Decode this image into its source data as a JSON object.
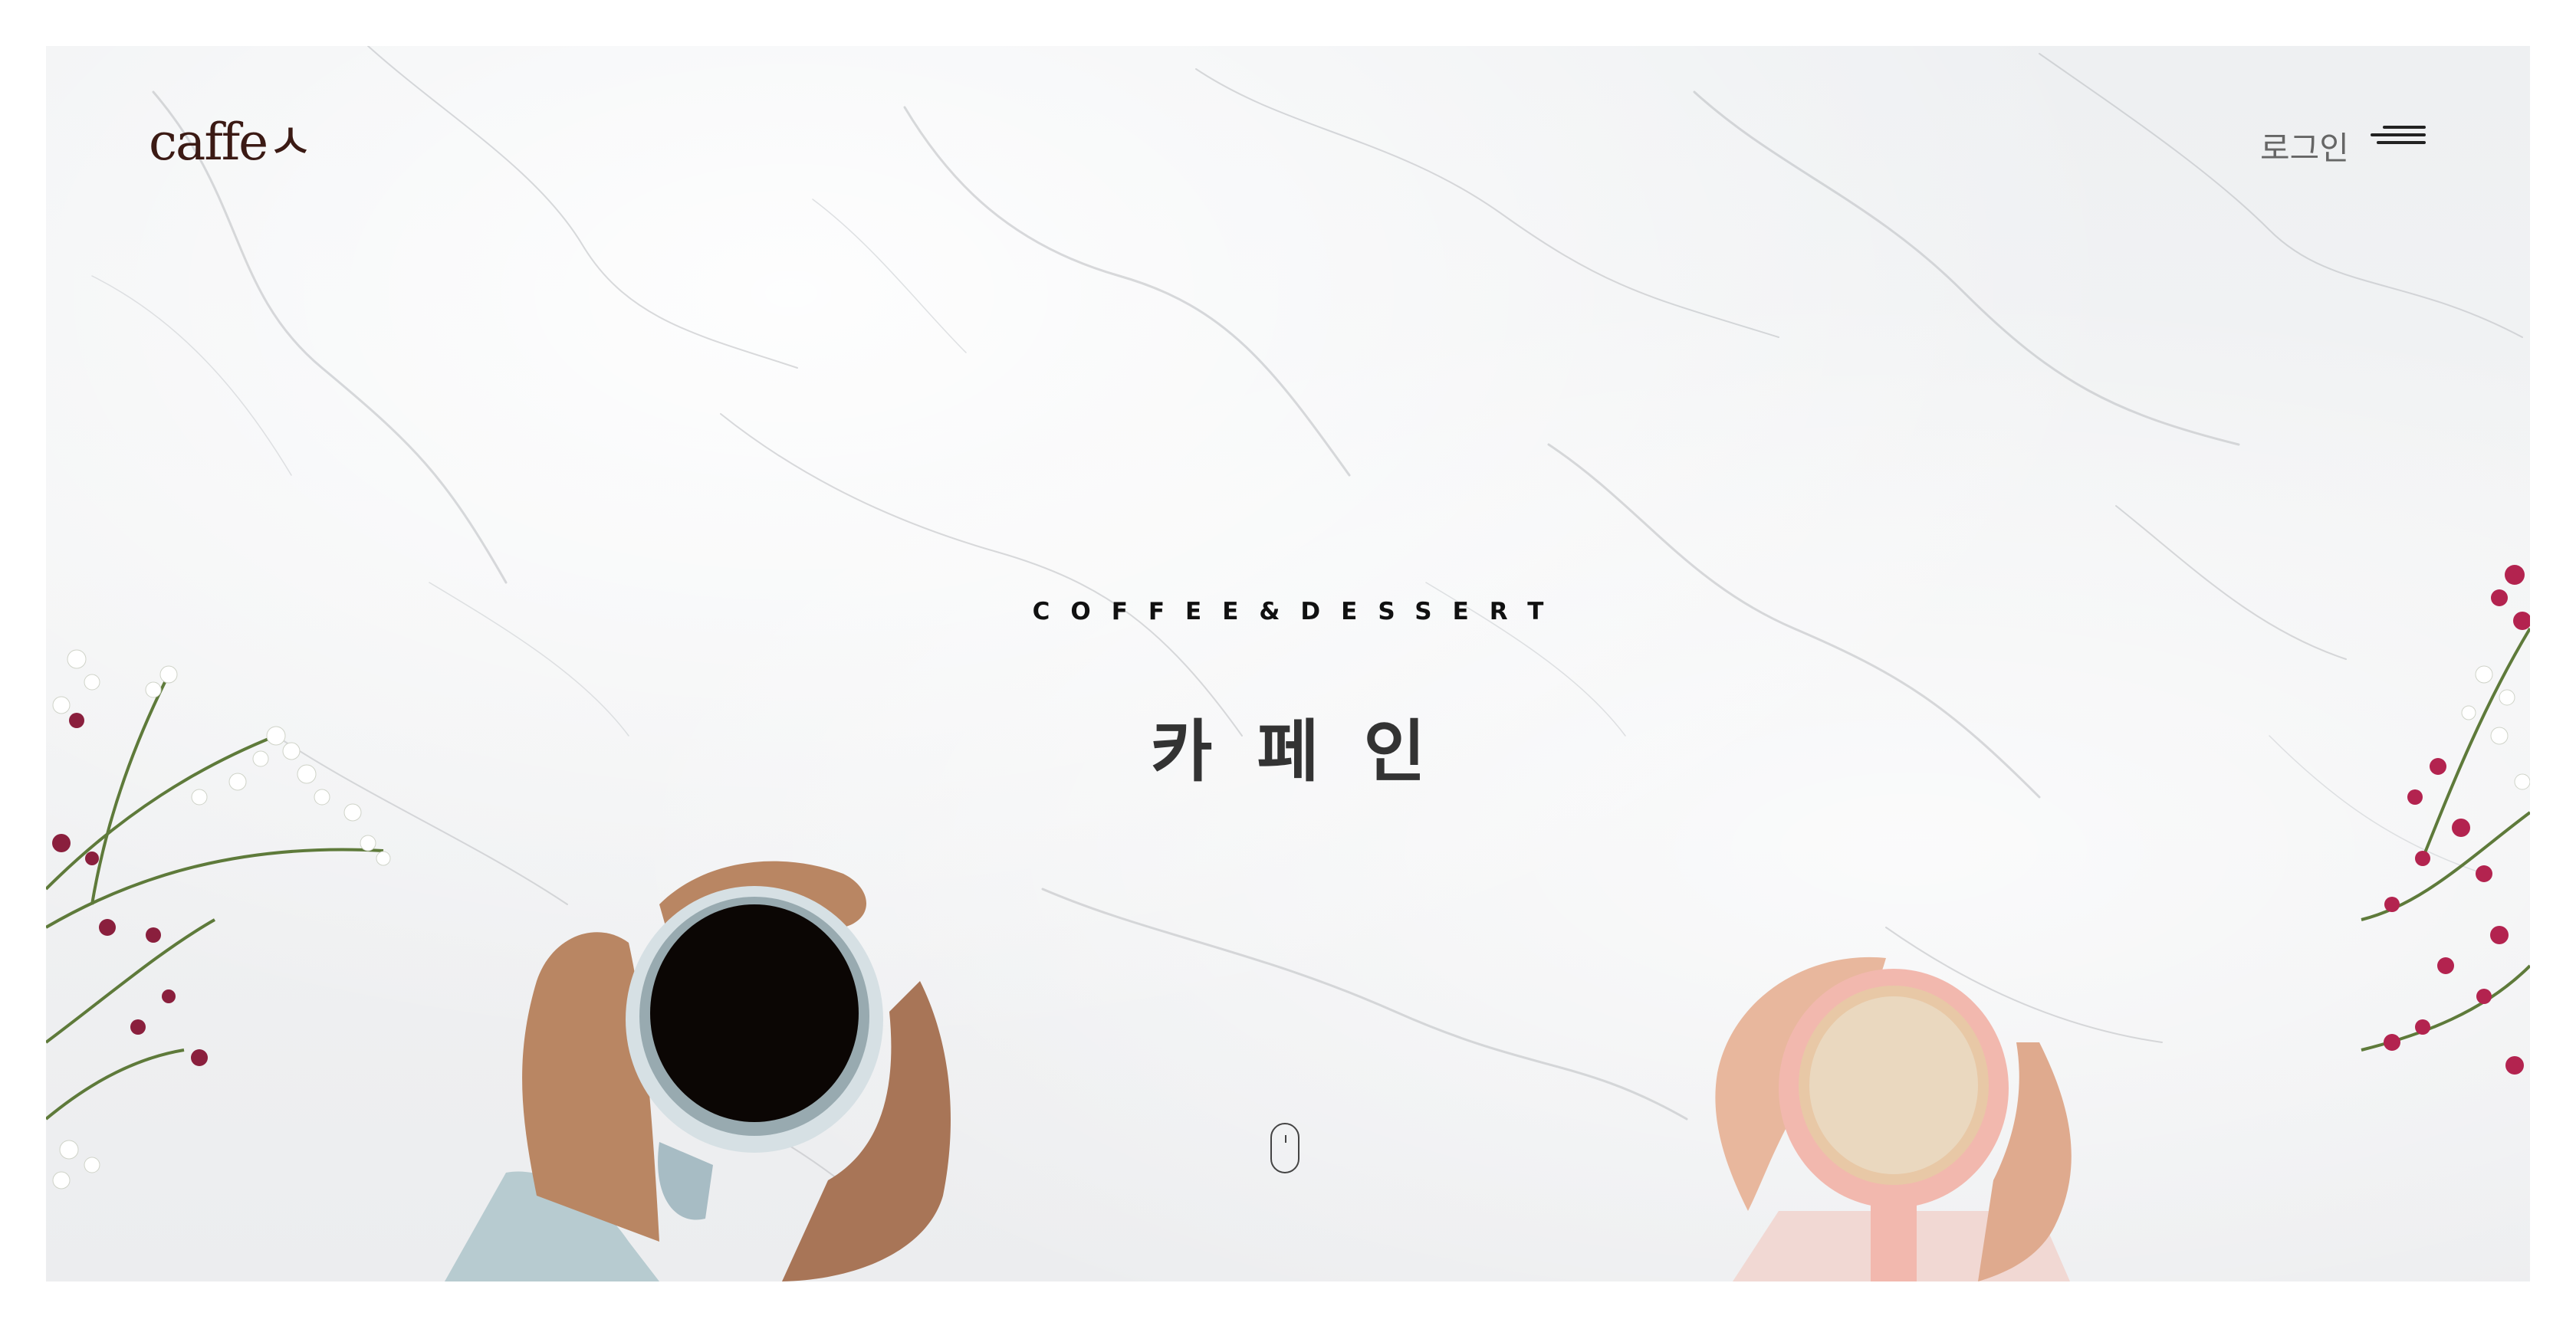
{
  "header": {
    "logo_text": "caffeㅅ",
    "login_label": "로그인",
    "menu_icon": "hamburger-icon"
  },
  "hero": {
    "subtitle": "COFFEE&DESSERT",
    "title": "카페인",
    "scroll_icon": "mouse-scroll-icon"
  },
  "colors": {
    "logo": "#3b1a14",
    "background": "#eef0f2",
    "text_dark": "#333333",
    "login": "#666666"
  }
}
